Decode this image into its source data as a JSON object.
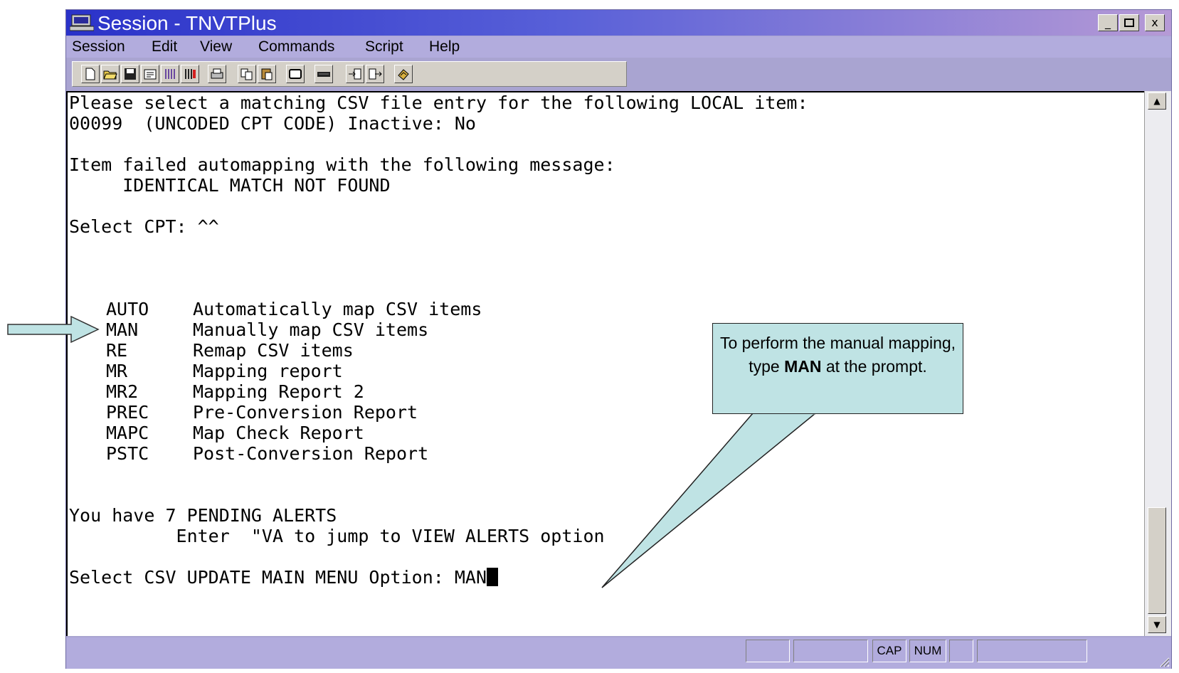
{
  "window": {
    "title": "Session - TNVTPlus",
    "controls": {
      "minimize": "_",
      "maximize": "□",
      "close": "x"
    }
  },
  "menubar": {
    "items": [
      "Session",
      "Edit",
      "View",
      "Commands",
      "Script",
      "Help"
    ]
  },
  "toolbar": {
    "icons": [
      "new-document-icon",
      "open-folder-icon",
      "save-icon",
      "properties-icon",
      "connect-icon",
      "disconnect-icon",
      "print-icon",
      "copy-icon",
      "paste-icon",
      "window-icon",
      "keyboard-icon",
      "send-file-icon",
      "receive-file-icon",
      "macro-icon"
    ]
  },
  "terminal": {
    "prompt_header": "Please select a matching CSV file entry for the following LOCAL item:",
    "item_line": "00099  (UNCODED CPT CODE) Inactive: No",
    "failed_line": "Item failed automapping with the following message:",
    "failed_message": "     IDENTICAL MATCH NOT FOUND",
    "select_cpt": "Select CPT: ^^",
    "menu_options": [
      {
        "code": "AUTO",
        "description": "Automatically map CSV items"
      },
      {
        "code": "MAN",
        "description": "Manually map CSV items"
      },
      {
        "code": "RE",
        "description": "Remap CSV items"
      },
      {
        "code": "MR",
        "description": "Mapping report"
      },
      {
        "code": "MR2",
        "description": "Mapping Report 2"
      },
      {
        "code": "PREC",
        "description": "Pre-Conversion Report"
      },
      {
        "code": "MAPC",
        "description": "Map Check Report"
      },
      {
        "code": "PSTC",
        "description": "Post-Conversion Report"
      }
    ],
    "alerts_line": "You have 7 PENDING ALERTS",
    "alerts_hint": "          Enter  \"VA to jump to VIEW ALERTS option",
    "input_prompt": "Select CSV UPDATE MAIN MENU Option: ",
    "input_value": "MAN"
  },
  "statusbar": {
    "caps": "CAP",
    "num": "NUM"
  },
  "callout": {
    "text_before": "To perform the manual mapping, type ",
    "bold_text": "MAN",
    "text_after": " at the prompt."
  },
  "colors": {
    "title_gradient_start": "#2a32c9",
    "title_gradient_end": "#b69ad6",
    "chrome": "#b2acdd",
    "callout_fill": "#bfe3e4"
  }
}
